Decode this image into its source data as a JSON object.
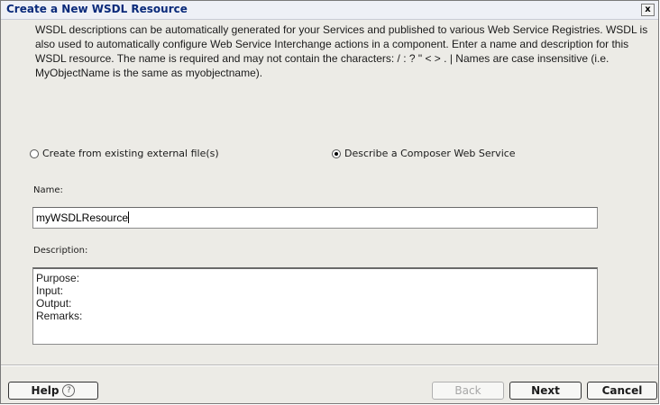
{
  "window": {
    "title": "Create a New WSDL Resource",
    "close_glyph": "x"
  },
  "intro": {
    "text": "WSDL descriptions can be automatically generated for your Services and published to various Web Service Registries. WSDL is also used to automatically configure Web Service Interchange actions in a component. Enter a name and description for this WSDL resource. The name is required and may not contain the characters: / : ? \" < > . | Names are case insensitive (i.e. MyObjectName is the same as myobjectname)."
  },
  "options": {
    "external": {
      "label": "Create from existing external file(s)",
      "selected": false
    },
    "composer": {
      "label": "Describe a Composer Web Service",
      "selected": true
    }
  },
  "name_field": {
    "label": "Name:",
    "value": "myWSDLResource"
  },
  "description_field": {
    "label": "Description:",
    "lines": [
      "Purpose:",
      "Input:",
      "Output:",
      "Remarks:"
    ]
  },
  "buttons": {
    "help": "Help",
    "help_icon": "?",
    "back": "Back",
    "next": "Next",
    "cancel": "Cancel"
  }
}
